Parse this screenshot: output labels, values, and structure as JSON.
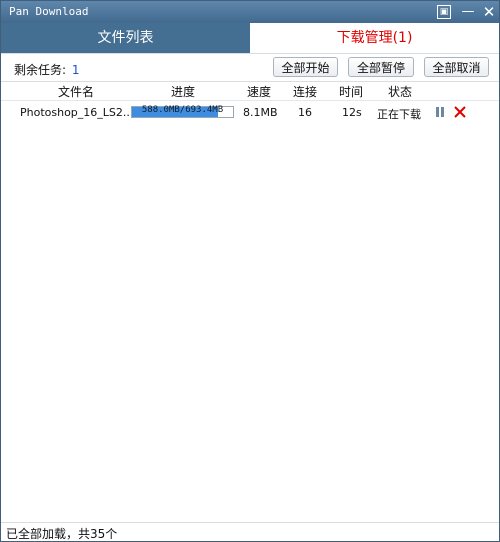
{
  "window": {
    "title": "Pan Download",
    "buttons": {
      "menu_symbol": "▣",
      "minimize_symbol": "—",
      "close_symbol": "✕"
    }
  },
  "tabs": [
    {
      "label": "文件列表",
      "active": false
    },
    {
      "label": "下载管理(1)",
      "active": true
    }
  ],
  "toolbar": {
    "remaining_label": "剩余任务:",
    "remaining_count": "1",
    "start_all": "全部开始",
    "pause_all": "全部暂停",
    "cancel_all": "全部取消"
  },
  "table": {
    "headers": [
      "文件名",
      "进度",
      "速度",
      "连接",
      "时间",
      "状态"
    ],
    "rows": [
      {
        "filename": "Photoshop_16_LS2...",
        "progress_text": "588.0MB/693.4MB",
        "progress_fraction": 0.848,
        "speed": "8.1MB",
        "connections": "16",
        "time": "12s",
        "status": "正在下载"
      }
    ]
  },
  "statusbar": {
    "text": "已全部加载，共35个"
  },
  "colors": {
    "accent": "#456f92",
    "progress": "#3f8de0",
    "tab_active_text": "#e00000",
    "remaining_count": "#1f4fd3"
  }
}
